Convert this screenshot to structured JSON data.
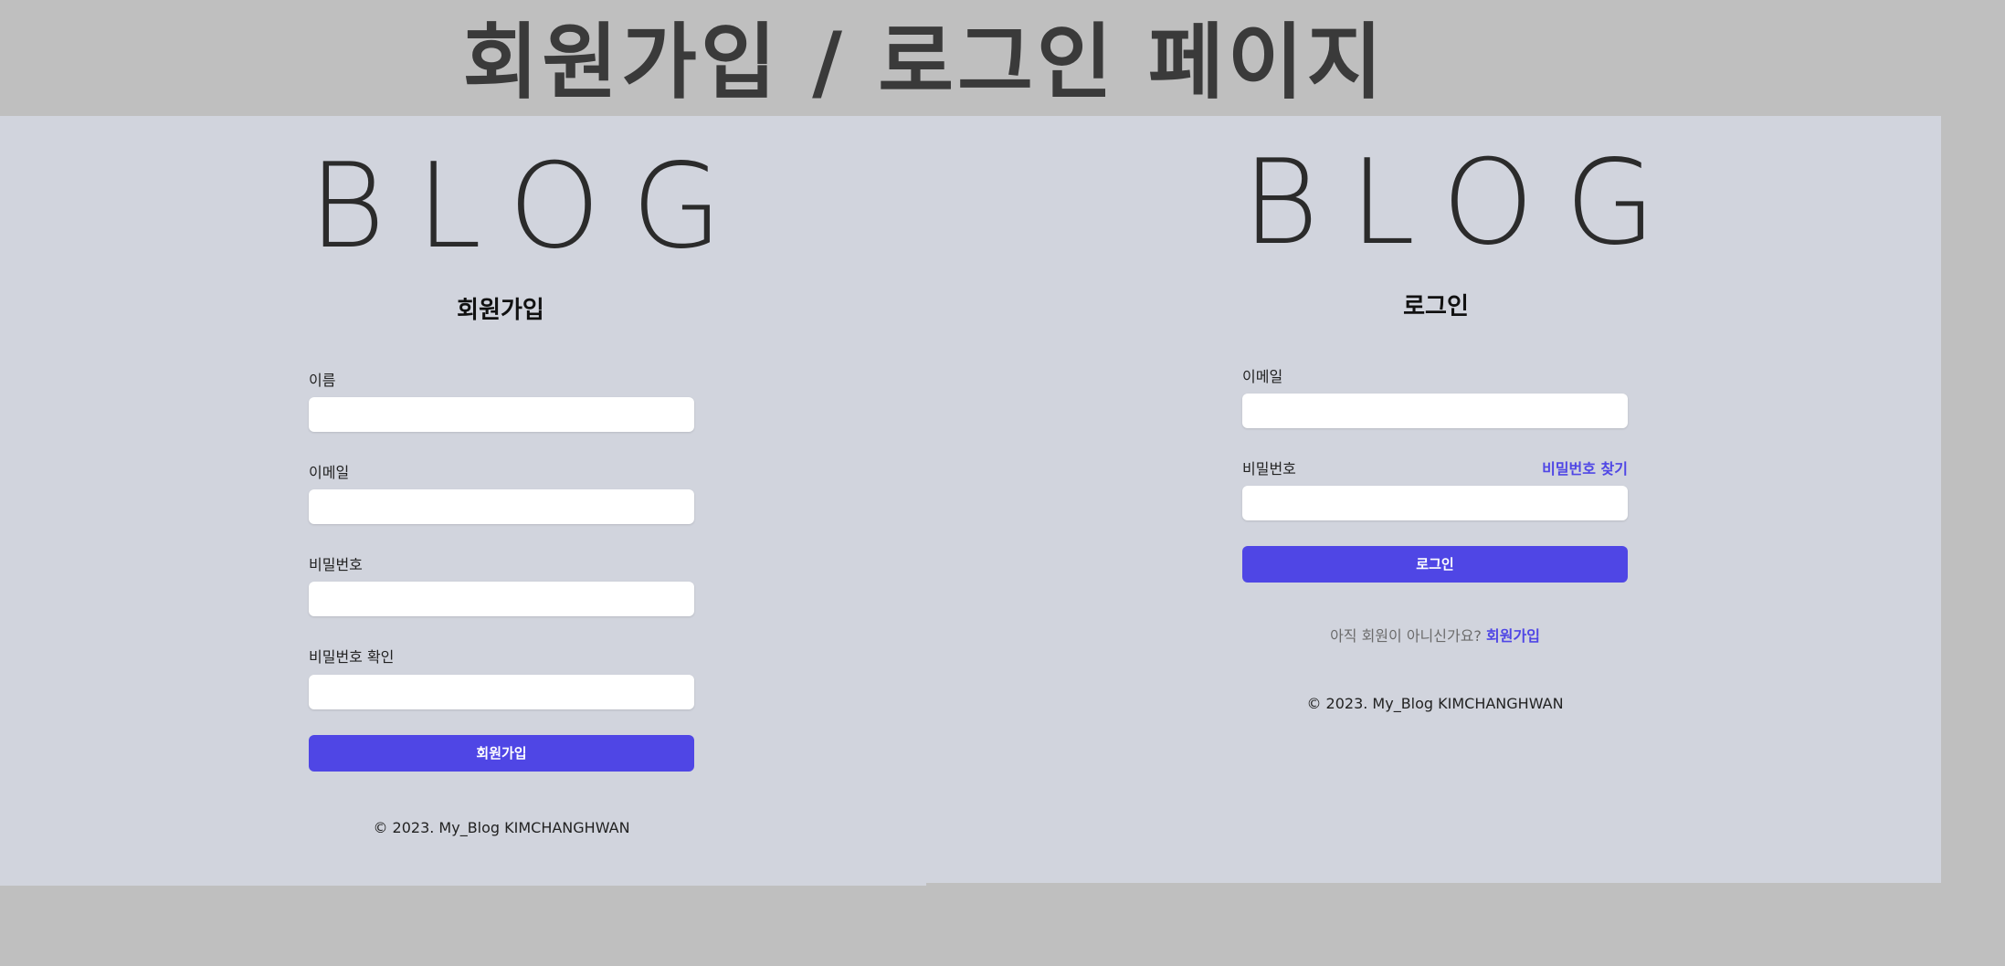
{
  "page": {
    "title": "회원가입 / 로그인 페이지"
  },
  "signup": {
    "logo": "BLOG",
    "heading": "회원가입",
    "fields": [
      {
        "label": "이름",
        "value": ""
      },
      {
        "label": "이메일",
        "value": ""
      },
      {
        "label": "비밀번호",
        "value": ""
      },
      {
        "label": "비밀번호 확인",
        "value": ""
      }
    ],
    "submit_label": "회원가입",
    "footer": "© 2023. My_Blog KIMCHANGHWAN"
  },
  "login": {
    "logo": "BLOG",
    "heading": "로그인",
    "email_label": "이메일",
    "password_label": "비밀번호",
    "forgot_label": "비밀번호 찾기",
    "submit_label": "로그인",
    "no_account_text": "아직 회원이 아니신가요?",
    "signup_link": "회원가입",
    "footer": "© 2023. My_Blog KIMCHANGHWAN"
  },
  "colors": {
    "accent": "#4f46e5",
    "panel": "#d1d4dd",
    "background": "#bfbfbf"
  }
}
